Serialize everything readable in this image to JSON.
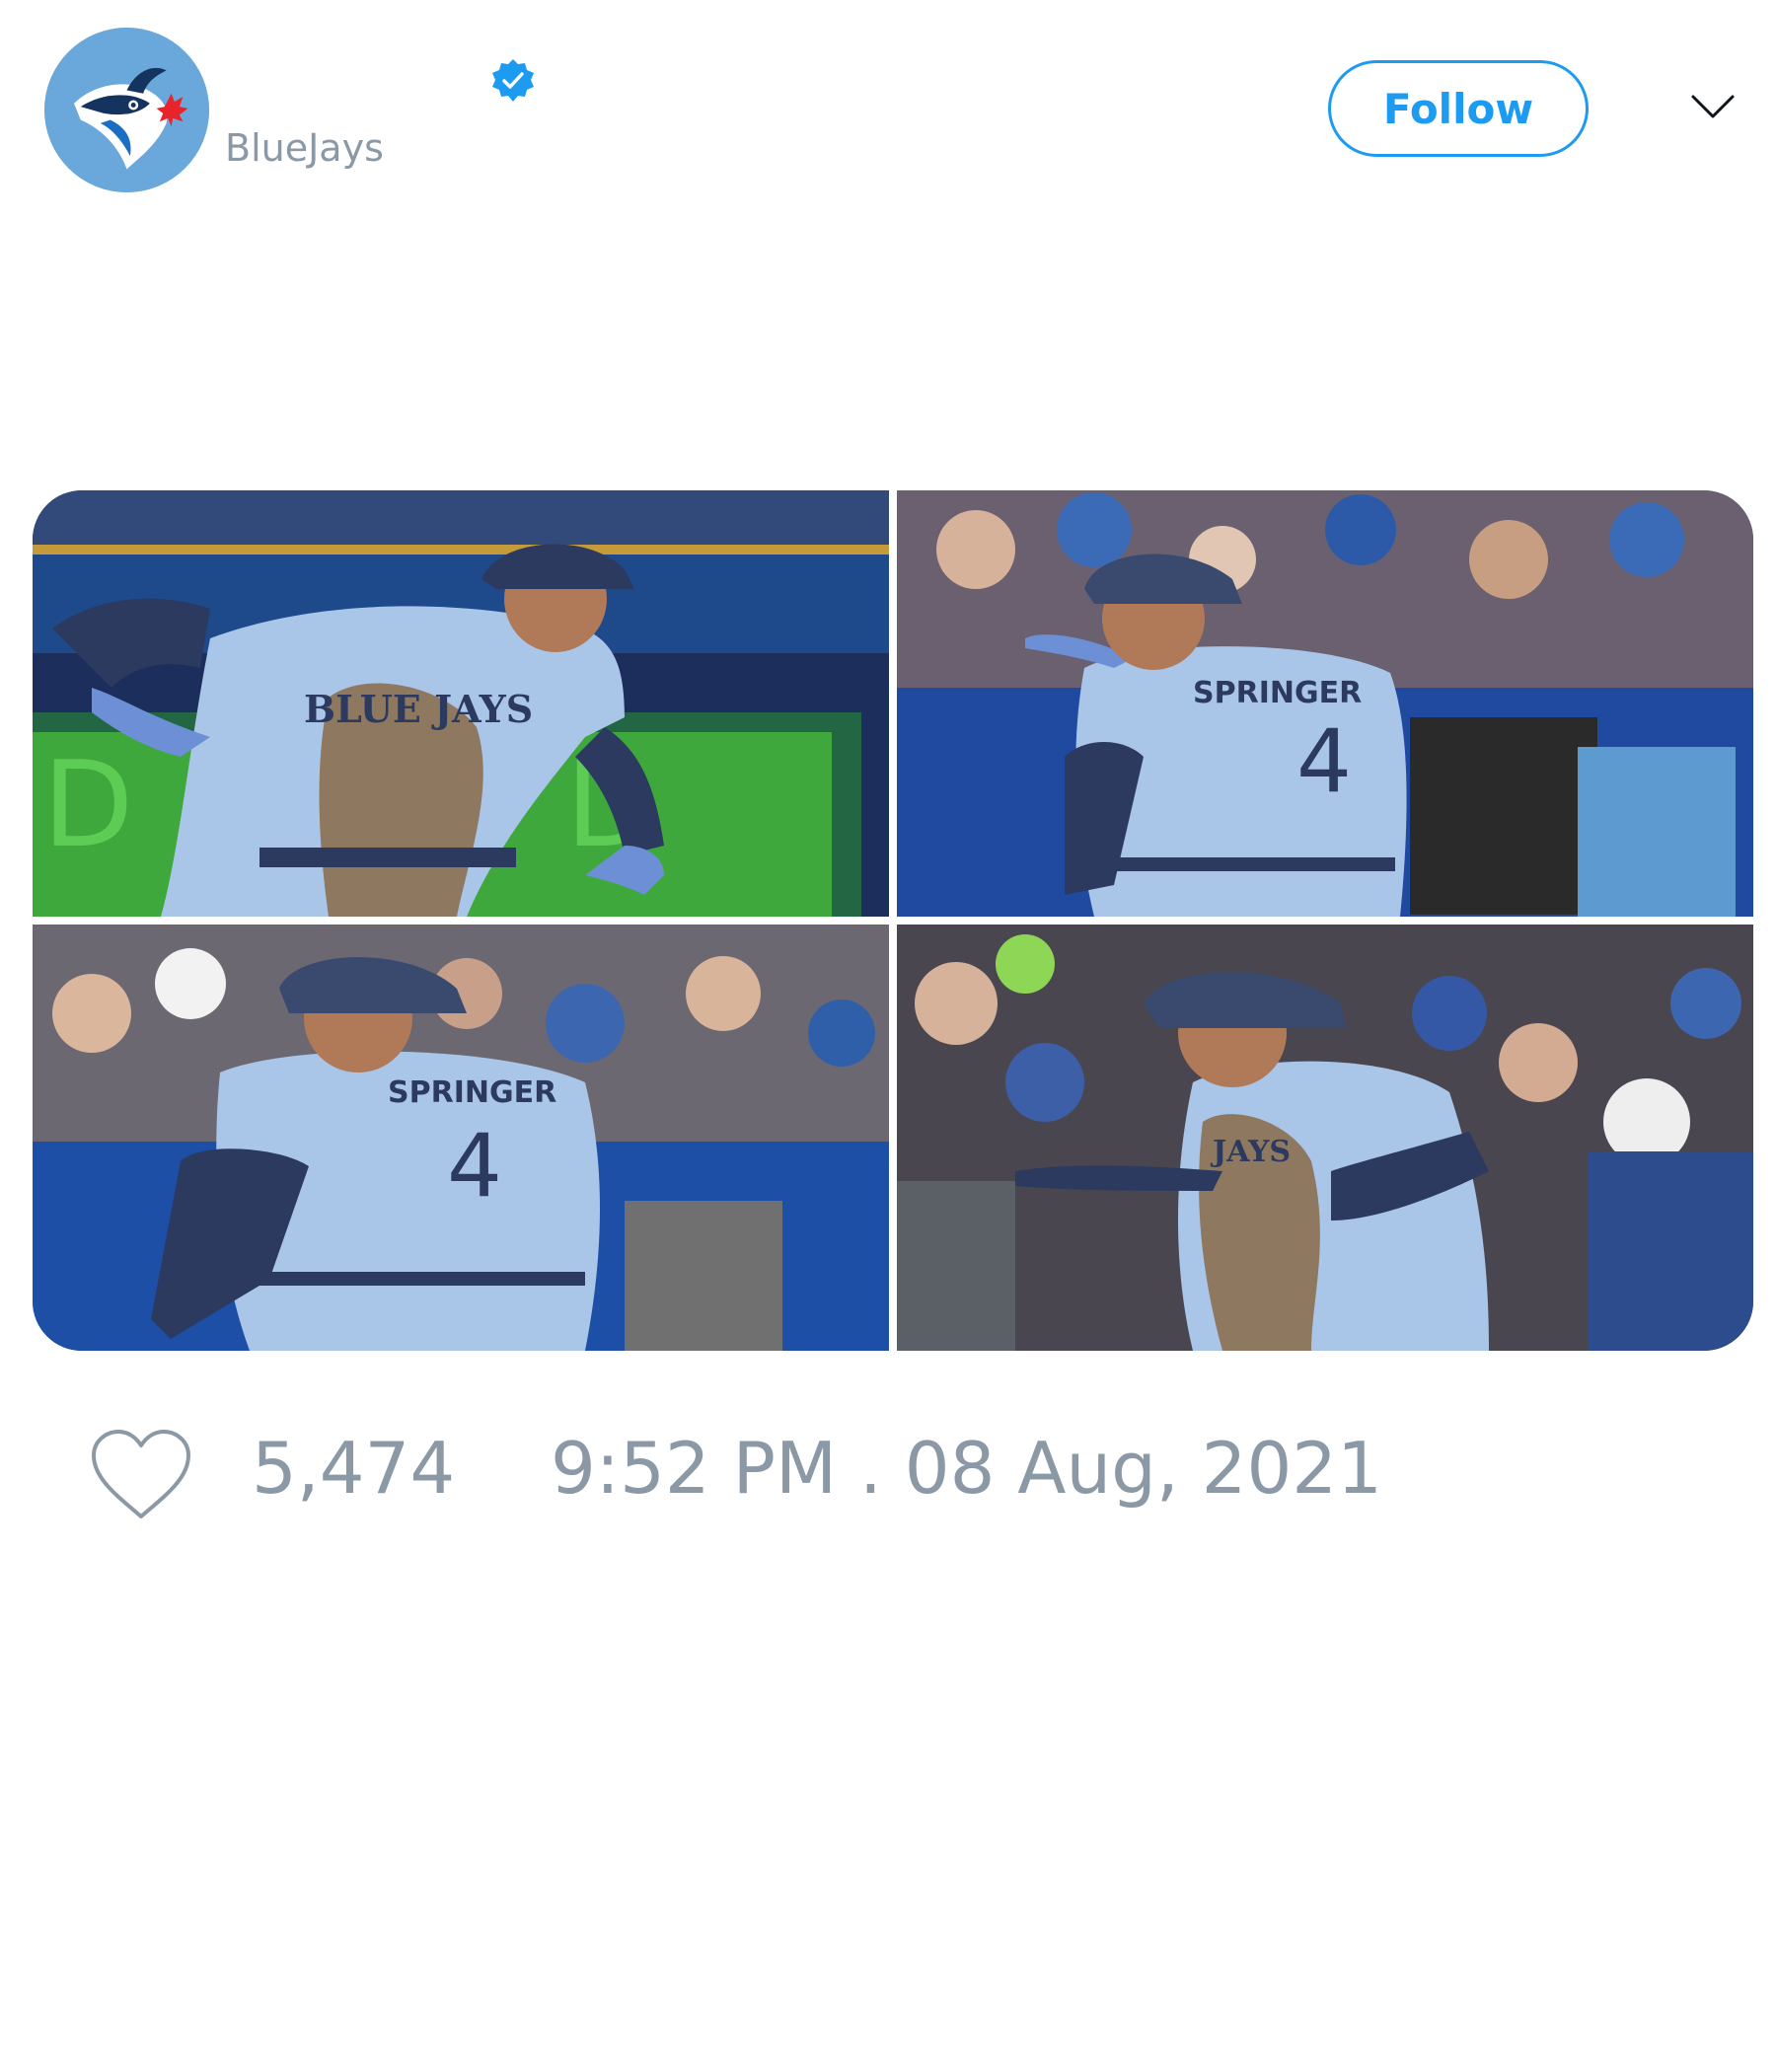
{
  "header": {
    "display_name": "",
    "handle": "BlueJays",
    "verified": true,
    "follow_label": "Follow"
  },
  "media": {
    "photos": [
      {
        "jersey_text": "BLUE JAYS"
      },
      {
        "jersey_text": "SPRINGER",
        "jersey_number": "4"
      },
      {
        "jersey_text": "SPRINGER",
        "jersey_number": "4"
      },
      {
        "jersey_text": "JAYS"
      }
    ]
  },
  "footer": {
    "like_count": "5,474",
    "timestamp": "9:52 PM . 08 Aug, 2021"
  },
  "colors": {
    "accent": "#1d9bf0",
    "muted_text": "#8b98a5",
    "avatar_bg": "#6aa8dc",
    "jersey": "#a9c6e8",
    "navy": "#2c3a5f"
  },
  "icons": {
    "avatar": "blue-jays-logo",
    "verified": "verified-badge-icon",
    "more": "chevron-down-icon",
    "like": "heart-outline-icon"
  }
}
